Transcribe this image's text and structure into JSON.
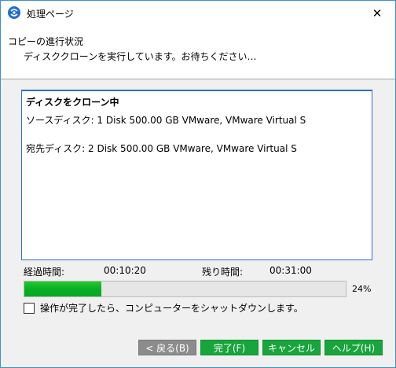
{
  "window": {
    "title": "処理ページ",
    "close_glyph": "✕",
    "accent_color": "#3c8fd6"
  },
  "header": {
    "title": "コピーの進行状況",
    "subtitle": "ディスククローンを実行しています。お待ちください…"
  },
  "log": {
    "heading": "ディスクをクローン中",
    "source": "ソースディスク: 1 Disk 500.00 GB VMware, VMware Virtual S",
    "target": "宛先ディスク: 2 Disk 500.00 GB VMware, VMware Virtual S"
  },
  "status": {
    "elapsed_label": "経過時間:",
    "elapsed_value": "00:10:20",
    "remaining_label": "残り時間:",
    "remaining_value": "00:31:00"
  },
  "progress": {
    "percent_text": "24%",
    "fraction": 0.24,
    "color": "#06b025"
  },
  "options": {
    "shutdown_label": "操作が完了したら、コンピューターをシャットダウンします。",
    "shutdown_checked": false
  },
  "buttons": {
    "back": "< 戻る(B)",
    "finish": "完了(F)",
    "cancel": "キャンセル",
    "help": "ヘルプ(H)",
    "primary_color": "#18a53c",
    "disabled_color": "#8c8c8c"
  }
}
